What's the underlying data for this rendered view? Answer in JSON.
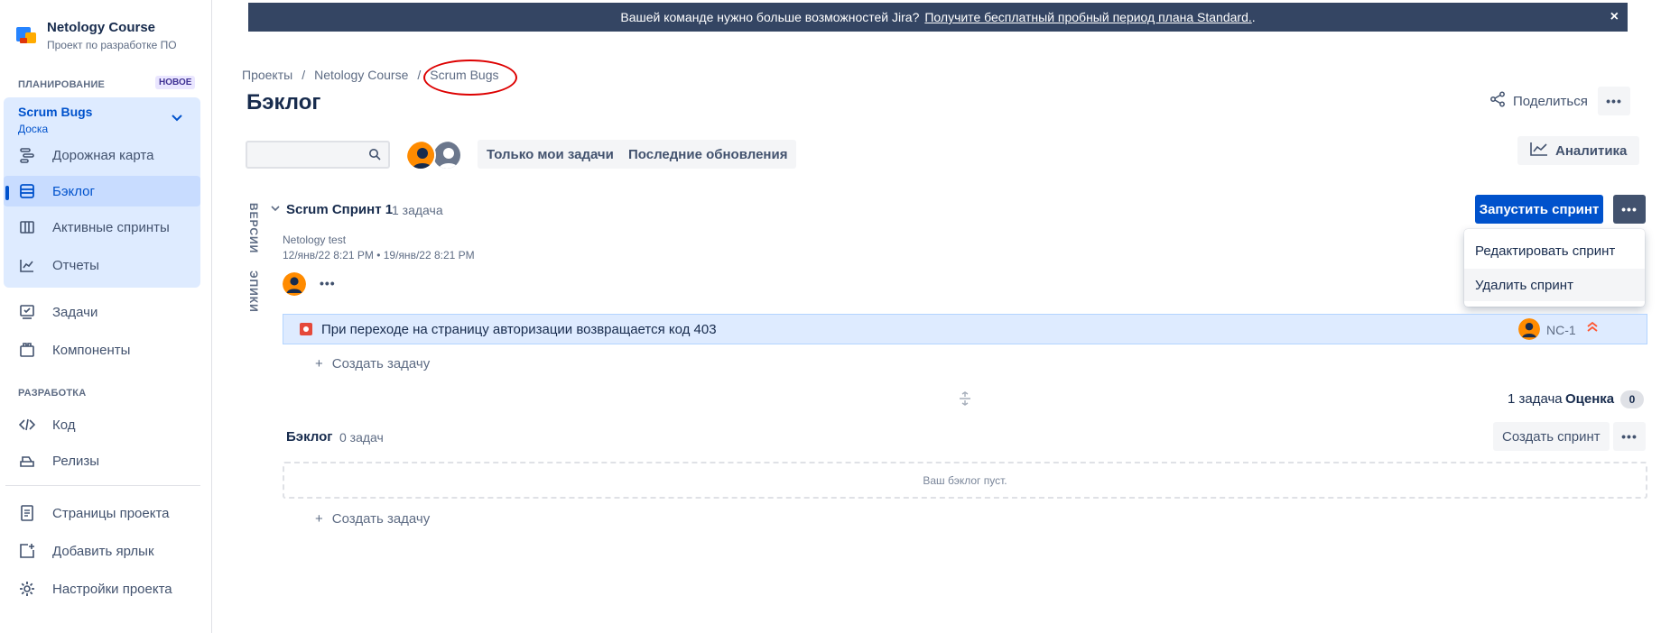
{
  "sidebar": {
    "project_name": "Netology Course",
    "project_sub": "Проект по разработке ПО",
    "planning_label": "ПЛАНИРОВАНИЕ",
    "new_badge": "НОВОЕ",
    "board_name": "Scrum Bugs",
    "board_sub": "Доска",
    "planning_items": [
      {
        "label": "Дорожная карта",
        "icon": "roadmap-icon"
      },
      {
        "label": "Бэклог",
        "icon": "backlog-icon"
      },
      {
        "label": "Активные спринты",
        "icon": "board-icon"
      },
      {
        "label": "Отчеты",
        "icon": "reports-icon"
      }
    ],
    "other_items": [
      {
        "label": "Задачи",
        "icon": "issues-icon"
      },
      {
        "label": "Компоненты",
        "icon": "components-icon"
      }
    ],
    "dev_label": "РАЗРАБОТКА",
    "dev_items": [
      {
        "label": "Код",
        "icon": "code-icon"
      },
      {
        "label": "Релизы",
        "icon": "releases-icon"
      }
    ],
    "bottom_items": [
      {
        "label": "Страницы проекта",
        "icon": "pages-icon"
      },
      {
        "label": "Добавить ярлык",
        "icon": "add-shortcut-icon"
      },
      {
        "label": "Настройки проекта",
        "icon": "settings-icon"
      }
    ]
  },
  "banner": {
    "text": "Вашей команде нужно больше возможностей Jira?",
    "link": "Получите бесплатный пробный период плана Standard.",
    "close": "×"
  },
  "breadcrumb": [
    "Проекты",
    "Netology Course",
    "Scrum Bugs"
  ],
  "page_title": "Бэклог",
  "header": {
    "share": "Поделиться",
    "more": "•••"
  },
  "filters": {
    "search_placeholder": "",
    "only_mine": "Только мои задачи",
    "recent": "Последние обновления",
    "analytics": "Аналитика"
  },
  "side_tabs": {
    "versions": "ВЕРСИИ",
    "epics": "ЭПИКИ"
  },
  "sprint": {
    "name": "Scrum Спринт 1",
    "count": "1 задача",
    "goal": "Netology test",
    "dates": "12/янв/22 8:21 PM • 19/янв/22 8:21 PM",
    "start": "Запустить спринт",
    "more": "•••",
    "menu": [
      "Редактировать спринт",
      "Удалить спринт"
    ],
    "issue": {
      "summary": "При переходе на страницу авторизации возвращается код 403",
      "key": "NC-1",
      "type": "bug",
      "priority": "highest"
    },
    "create_issue": "Создать задачу",
    "footer_count": "1 задача",
    "estimate_label": "Оценка",
    "estimate_value": "0"
  },
  "backlog": {
    "title": "Бэклог",
    "count": "0 задач",
    "create_sprint": "Создать спринт",
    "more": "•••",
    "empty": "Ваш бэклог пуст.",
    "create_issue": "Создать задачу"
  },
  "colors": {
    "accent": "#0052CC",
    "banner": "#344563",
    "annotation": "#DD0000"
  }
}
